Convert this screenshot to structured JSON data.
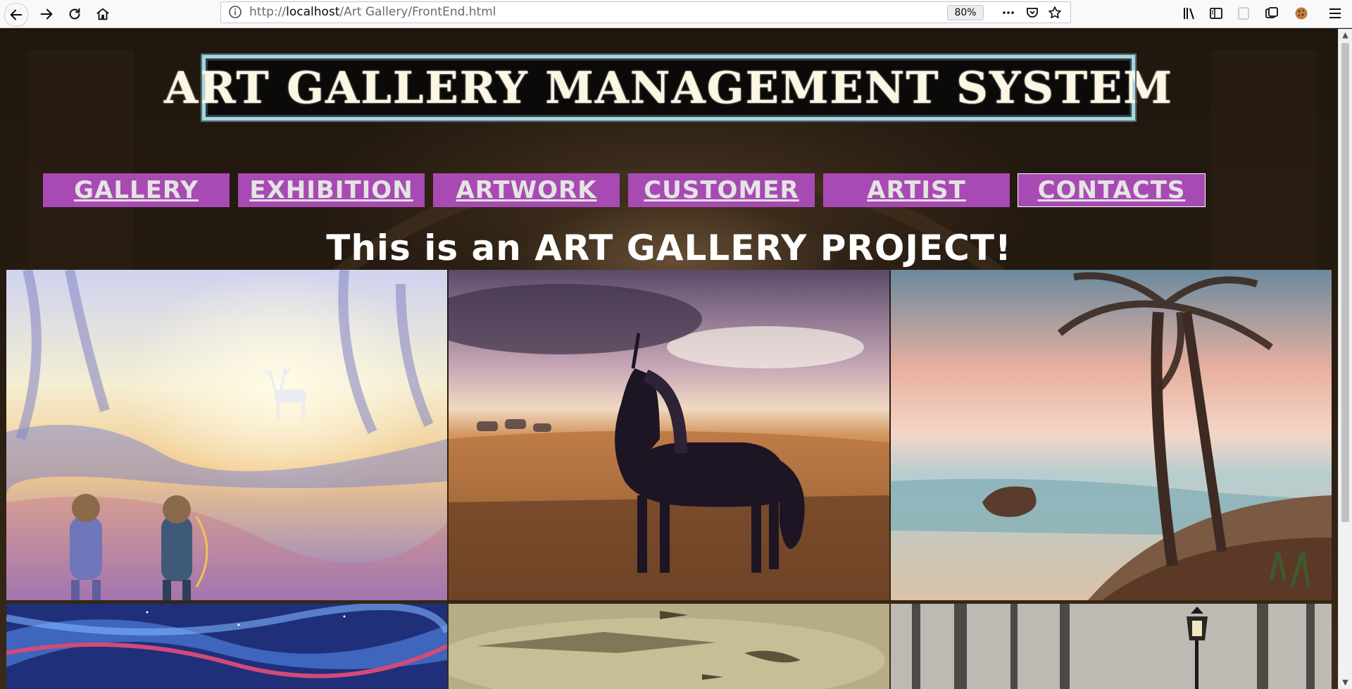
{
  "browser": {
    "url_scheme": "http://",
    "url_host": "localhost",
    "url_path": "/Art Gallery/FrontEnd.html",
    "zoom": "80%"
  },
  "page": {
    "title": "ART GALLERY MANAGEMENT SYSTEM",
    "headline": "This is an ART GALLERY PROJECT!",
    "nav": [
      {
        "label": "GALLERY"
      },
      {
        "label": "EXHIBITION"
      },
      {
        "label": "ARTWORK"
      },
      {
        "label": "CUSTOMER"
      },
      {
        "label": "ARTIST"
      },
      {
        "label": "CONTACTS"
      }
    ]
  },
  "colors": {
    "nav_bg": "#a84ab3",
    "nav_text": "#e4e4e4",
    "title_border": "#a9d3dd"
  }
}
